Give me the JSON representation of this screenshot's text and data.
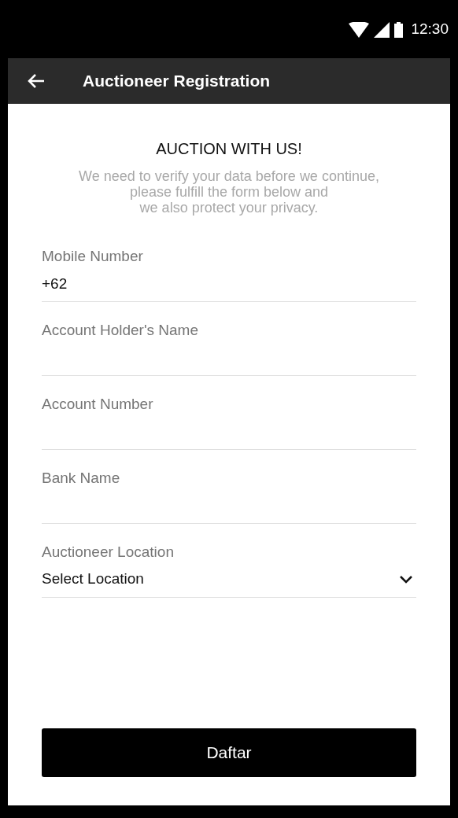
{
  "status_bar": {
    "time": "12:30"
  },
  "app_bar": {
    "title": "Auctioneer Registration"
  },
  "heading": "AUCTION WITH US!",
  "intro_lines": [
    "We need to verify your data before we continue,",
    "please fulfill the form below and",
    "we also protect your privacy."
  ],
  "fields": [
    {
      "kind": "text",
      "label": "Mobile Number",
      "value": "+62"
    },
    {
      "kind": "text",
      "label": "Account Holder's Name"
    },
    {
      "kind": "text",
      "label": "Account Number"
    },
    {
      "kind": "text",
      "label": "Bank Name"
    },
    {
      "kind": "select",
      "label": "Auctioneer Location",
      "value": "Select Location"
    }
  ],
  "submit": "Daftar"
}
